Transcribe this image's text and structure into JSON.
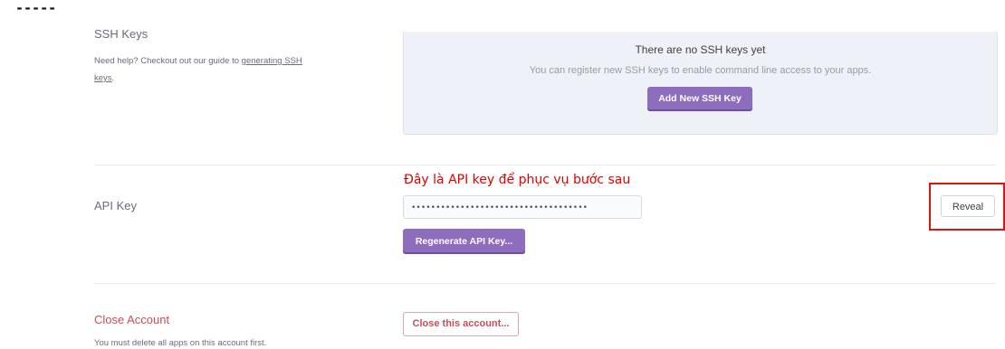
{
  "header_marker": "-----",
  "ssh": {
    "title": "SSH Keys",
    "help_prefix": "Need help? Checkout out our guide to ",
    "help_link": "generating SSH keys",
    "help_suffix": ".",
    "empty_title": "There are no SSH keys yet",
    "empty_sub": "You can register new SSH keys to enable command line access to your apps.",
    "add_button": "Add New SSH Key"
  },
  "annotation": "Đây là API key để phục vụ bước sau",
  "api": {
    "label": "API Key",
    "masked_value": "••••••••••••••••••••••••••••••••••••",
    "reveal_button": "Reveal",
    "regenerate_button": "Regenerate API Key..."
  },
  "close_account": {
    "title": "Close Account",
    "note": "You must delete all apps on this account first.",
    "button": "Close this account..."
  },
  "colors": {
    "primary": "#8e6dbe",
    "danger": "#c94e57",
    "highlight": "#e01212"
  }
}
